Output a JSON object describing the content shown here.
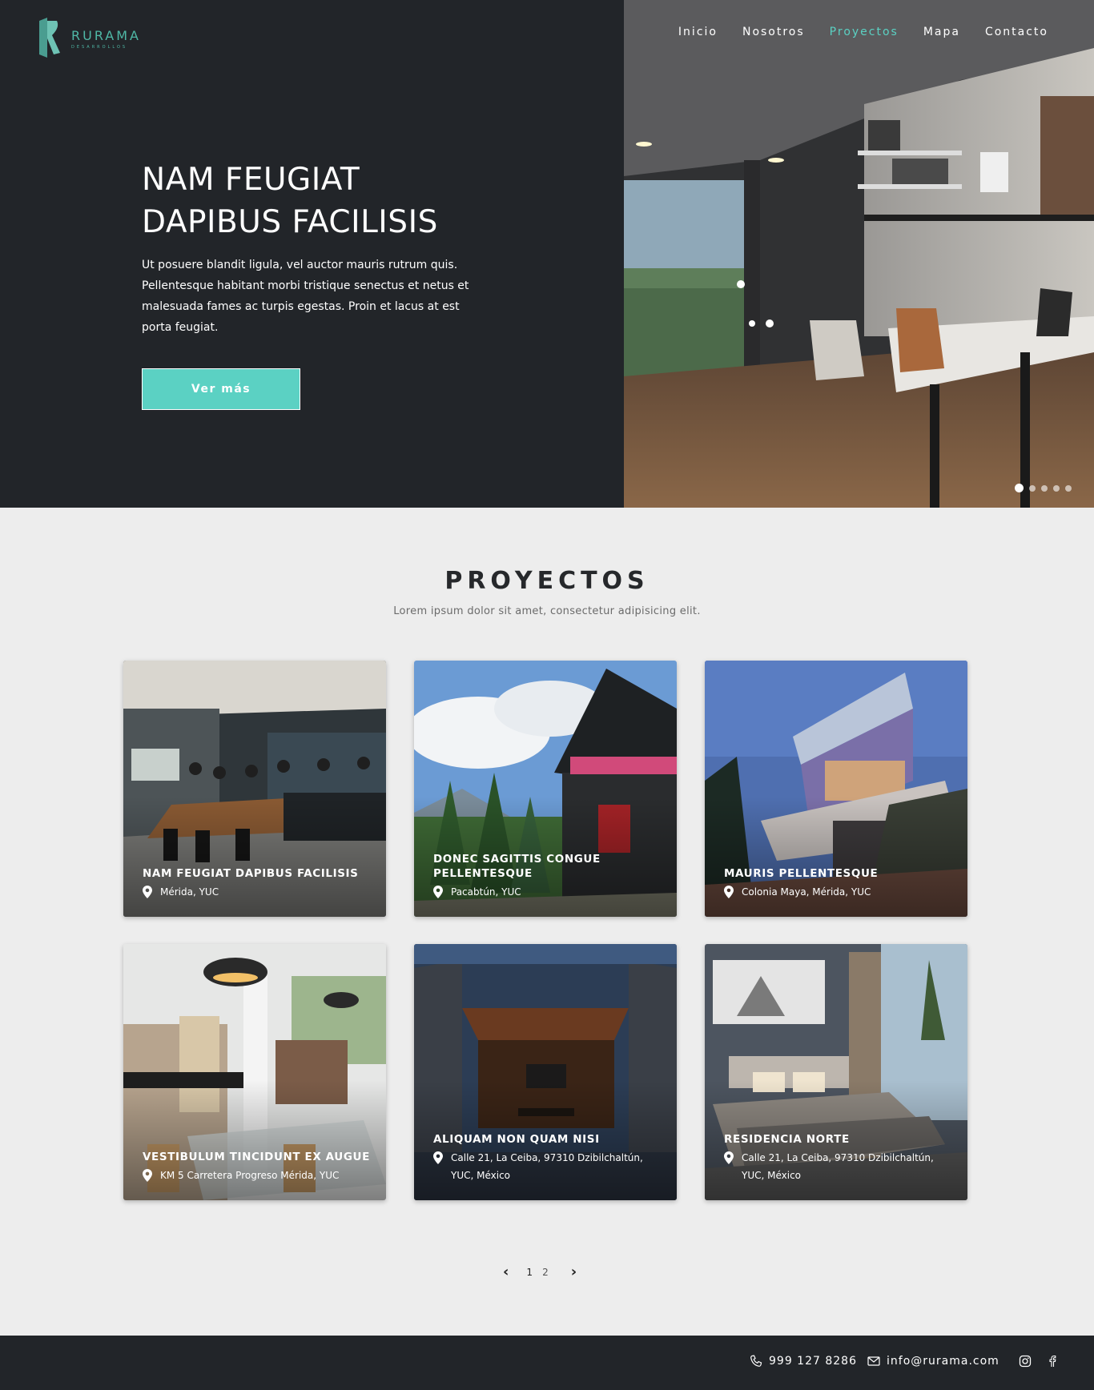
{
  "brand": {
    "name": "RURAMA",
    "tagline": "DESARROLLOS",
    "accent": "#5bd1c3"
  },
  "nav": {
    "items": [
      "Inicio",
      "Nosotros",
      "Proyectos",
      "Mapa",
      "Contacto"
    ],
    "active": "Proyectos"
  },
  "hero": {
    "title_line1": "NAM FEUGIAT",
    "title_line2": "DAPIBUS FACILISIS",
    "text": "Ut posuere blandit ligula, vel auctor mauris rutrum quis. Pellentesque habitant morbi tristique senectus et netus et malesuada fames ac turpis egestas. Proin et lacus at est porta feugiat.",
    "button": "Ver más",
    "slides": 5,
    "active_slide": 1
  },
  "projects": {
    "title": "PROYECTOS",
    "subtitle": "Lorem ipsum dolor sit amet, consectetur adipisicing elit.",
    "items": [
      {
        "title": "NAM FEUGIAT DAPIBUS FACILISIS",
        "location": "Mérida, YUC",
        "image": "kitchen-dining"
      },
      {
        "title": "DONEC SAGITTIS CONGUE PELLENTESQUE",
        "location": "Pacabtún, YUC",
        "image": "mountain-chalet"
      },
      {
        "title": "MAURIS PELLENTESQUE",
        "location": "Colonia Maya, Mérida, YUC",
        "image": "modern-house-dusk"
      },
      {
        "title": "VESTIBULUM TINCIDUNT EX AUGUE",
        "location": "KM 5 Carretera Progreso Mérida, YUC",
        "image": "bright-dining"
      },
      {
        "title": "ALIQUAM NON QUAM NISI",
        "location": "Calle 21, La Ceiba, 97310 Dzibilchaltún, YUC, México",
        "image": "courtyard-night"
      },
      {
        "title": "RESIDENCIA NORTE",
        "location": "Calle 21, La Ceiba, 97310 Dzibilchaltún, YUC, México",
        "image": "bedroom"
      }
    ]
  },
  "pagination": {
    "prev": "‹",
    "pages": [
      "1",
      "2"
    ],
    "current": "1",
    "next": "›"
  },
  "footer": {
    "phone": "999 127 8286",
    "email": "info@rurama.com",
    "social": [
      "instagram-icon",
      "facebook-icon"
    ]
  }
}
